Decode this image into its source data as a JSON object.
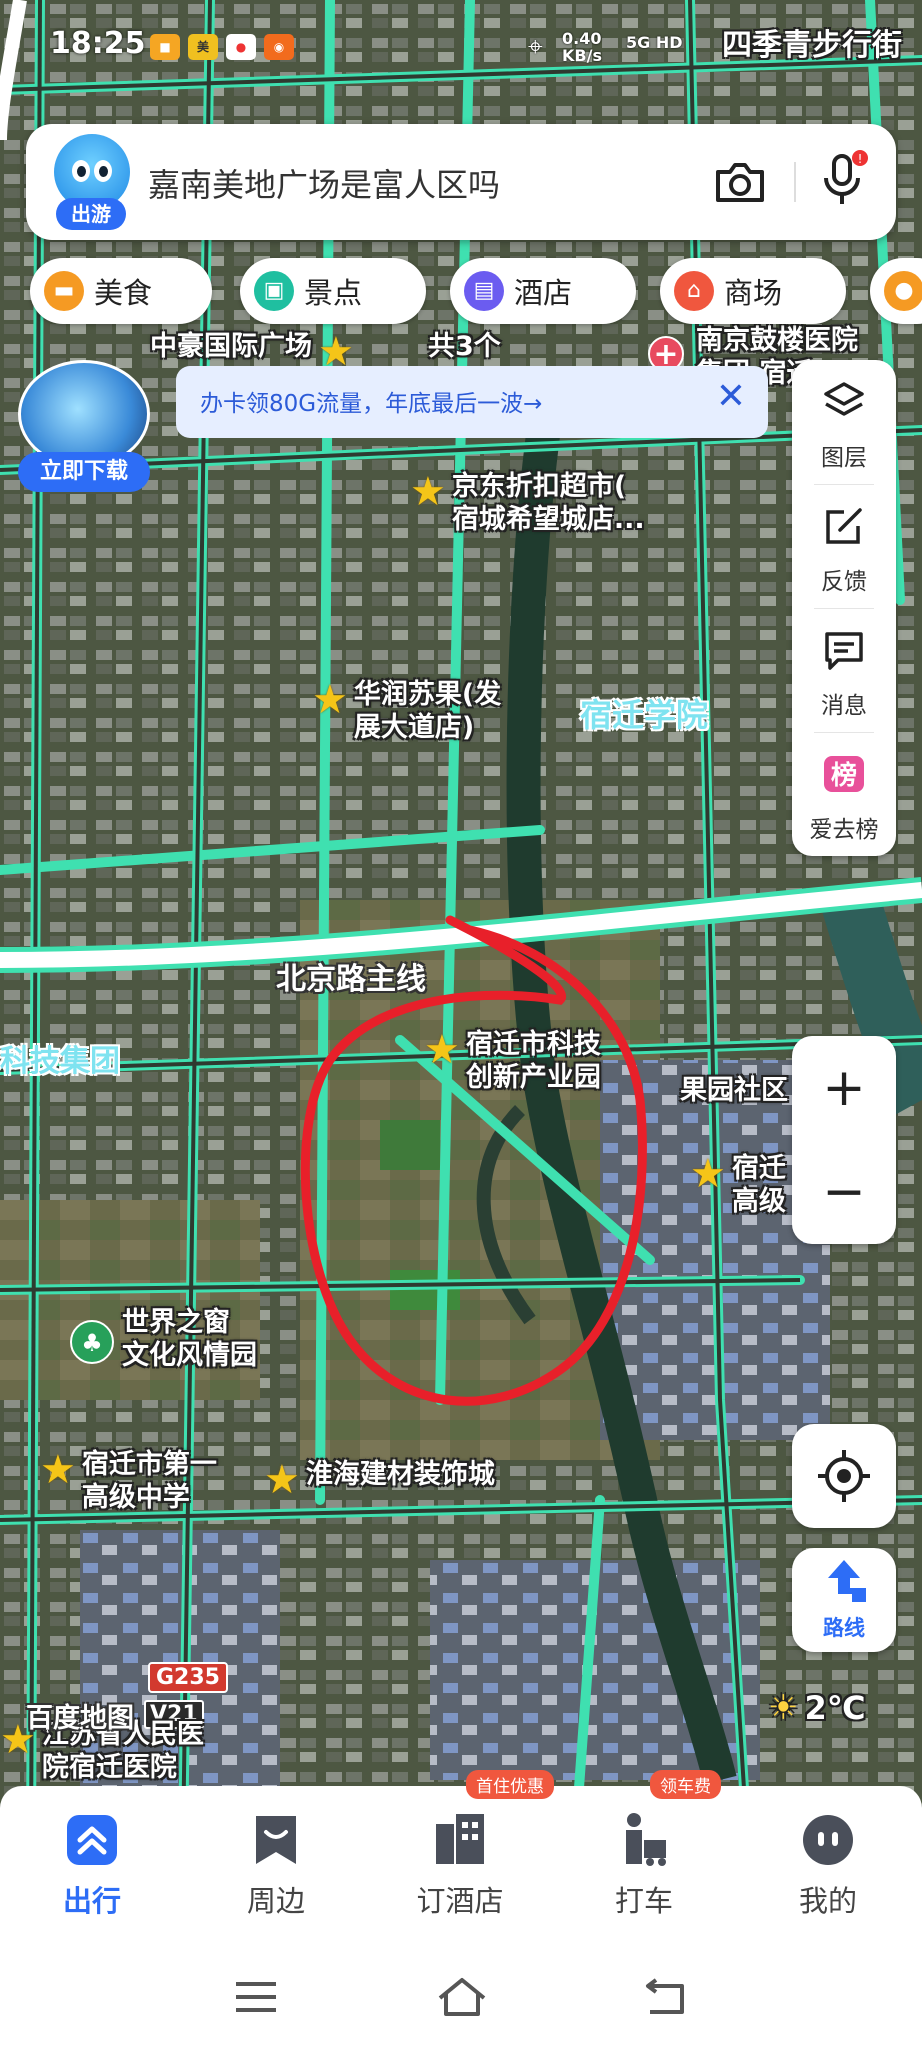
{
  "status_bar": {
    "time": "18:25",
    "network_speed": "0.40\nKB/s",
    "network_type": "5G HD",
    "location_title": "四季青步行街"
  },
  "search": {
    "mascot_tag": "出游",
    "query": "嘉南美地广场是富人区吗",
    "camera_icon": "camera-icon",
    "mic_icon": "microphone-icon"
  },
  "categories": [
    {
      "label": "美食",
      "icon": "food-icon",
      "color": "#f59a23"
    },
    {
      "label": "景点",
      "icon": "scenic-icon",
      "color": "#1fbfa0"
    },
    {
      "label": "酒店",
      "icon": "hotel-icon",
      "color": "#6b5cf0"
    },
    {
      "label": "商场",
      "icon": "mall-icon",
      "color": "#f0573e"
    }
  ],
  "banner": {
    "text": "办卡领80G流量，年底最后一波→"
  },
  "download_avatar": {
    "button_label": "立即下载"
  },
  "right_tools": [
    {
      "label": "图层",
      "icon": "layers-icon"
    },
    {
      "label": "反馈",
      "icon": "feedback-icon"
    },
    {
      "label": "消息",
      "icon": "message-icon"
    },
    {
      "label": "爱去榜",
      "icon": "ranking-icon"
    }
  ],
  "zoom": {
    "in": "+",
    "out": "−"
  },
  "route_label": "路线",
  "weather": {
    "temp": "2℃"
  },
  "watermark": "百度地图",
  "map_labels": {
    "poi_1": "中豪国际广场",
    "poi_1_count": "共3个",
    "hospital": "南京鼓楼医院\n集团 宿迁",
    "jd": "京东折扣超市(\n宿城希望城店...",
    "huarun": "华润苏果(发\n展大道店)",
    "xueyuan": "宿迁学院",
    "road": "北京路主线",
    "keji_jituan": "科技集团",
    "keji_yuan": "宿迁市科技\n创新产业园",
    "guoyuan": "果园社区",
    "suqian_gao": "宿迁\n高级",
    "shijie": "世界之窗\n文化风情园",
    "diyi_gaozhong": "宿迁市第一\n高级中学",
    "huaihai": "淮海建材装饰城",
    "renmin_hosp": "江苏省人民医\n院宿迁医院",
    "g235": "G235",
    "v21": "V21"
  },
  "bottom_nav": [
    {
      "label": "出行",
      "icon": "travel-icon",
      "active": true
    },
    {
      "label": "周边",
      "icon": "nearby-icon",
      "active": false
    },
    {
      "label": "订酒店",
      "icon": "hotel-booking-icon",
      "active": false,
      "badge": "首住优惠"
    },
    {
      "label": "打车",
      "icon": "taxi-icon",
      "active": false,
      "badge": "领车费"
    },
    {
      "label": "我的",
      "icon": "profile-icon",
      "active": false
    }
  ],
  "accent_color": "#2d6df6",
  "annotation_color": "#e8202a"
}
